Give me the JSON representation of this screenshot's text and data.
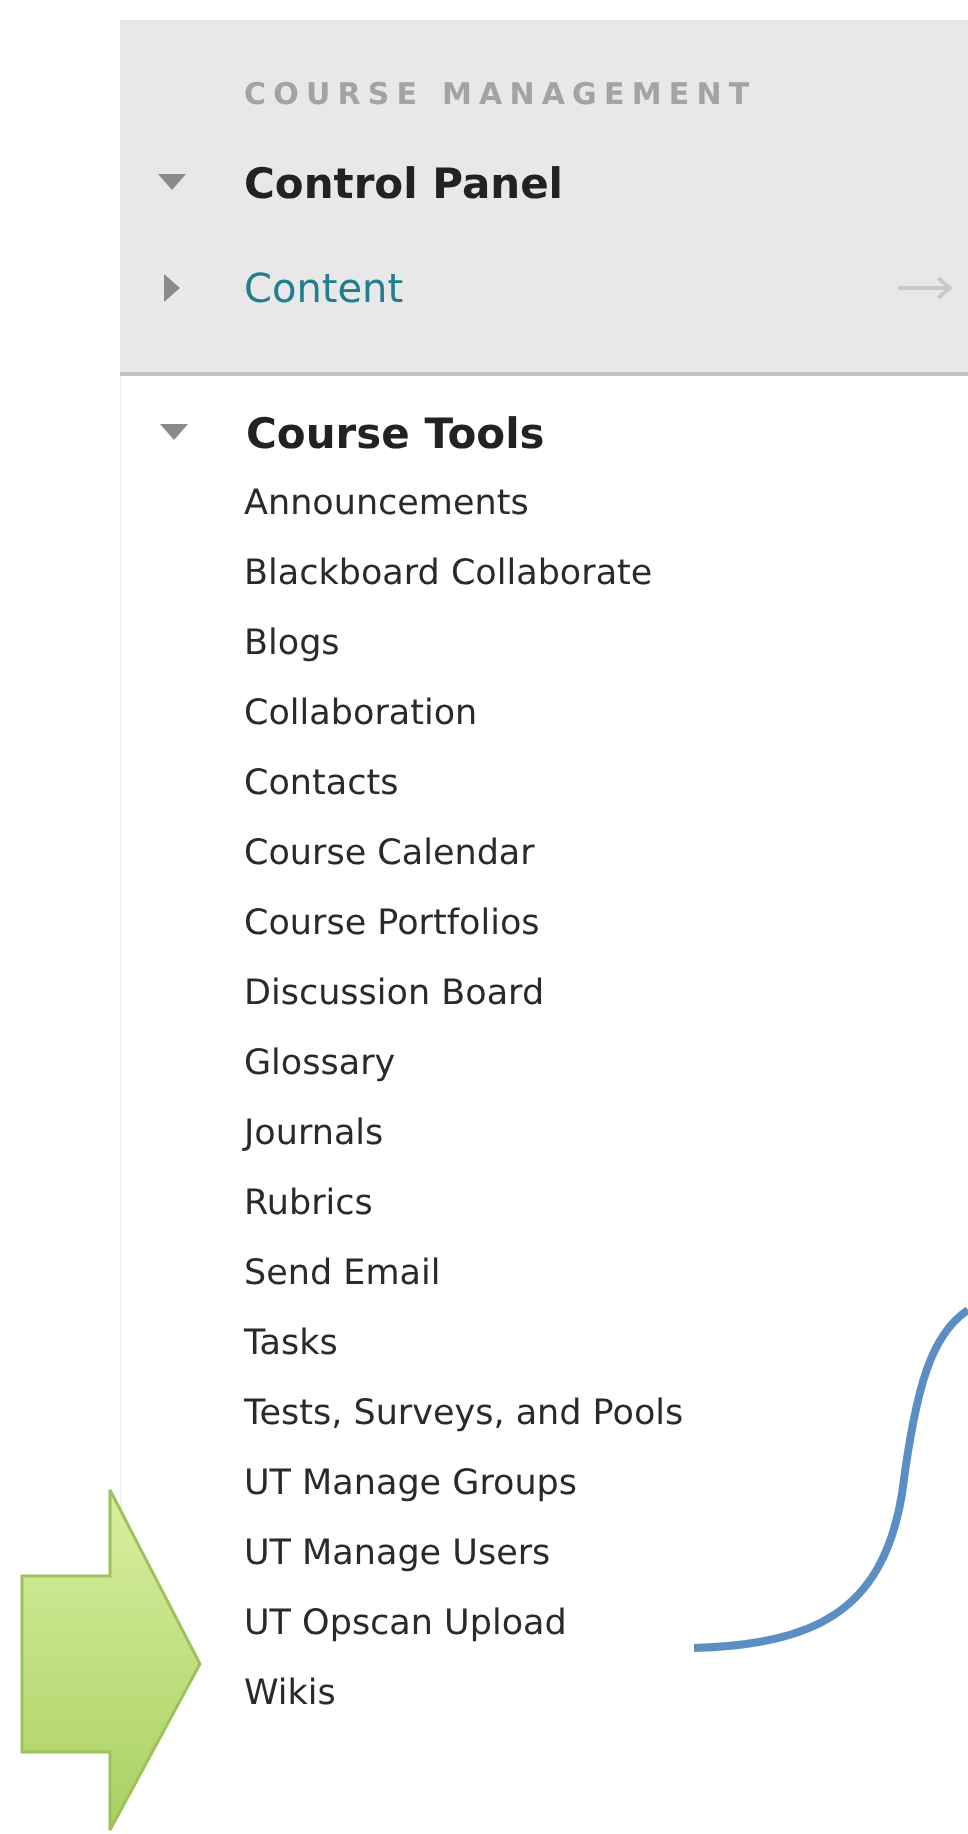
{
  "section_title": "COURSE MANAGEMENT",
  "panel_items": [
    {
      "label": "Control Panel",
      "kind": "header",
      "expanded": true
    },
    {
      "label": "Content",
      "kind": "link",
      "expanded": false
    }
  ],
  "course_tools": {
    "label": "Course Tools",
    "expanded": true,
    "children": [
      {
        "label": "Announcements"
      },
      {
        "label": "Blackboard Collaborate"
      },
      {
        "label": "Blogs"
      },
      {
        "label": "Collaboration"
      },
      {
        "label": "Contacts"
      },
      {
        "label": "Course Calendar"
      },
      {
        "label": "Course Portfolios"
      },
      {
        "label": "Discussion Board"
      },
      {
        "label": "Glossary"
      },
      {
        "label": "Journals"
      },
      {
        "label": "Rubrics"
      },
      {
        "label": "Send Email"
      },
      {
        "label": "Tasks"
      },
      {
        "label": "Tests, Surveys, and Pools"
      },
      {
        "label": "UT Manage Groups"
      },
      {
        "label": "UT Manage Users"
      },
      {
        "label": "UT Opscan Upload"
      },
      {
        "label": "Wikis"
      }
    ]
  }
}
